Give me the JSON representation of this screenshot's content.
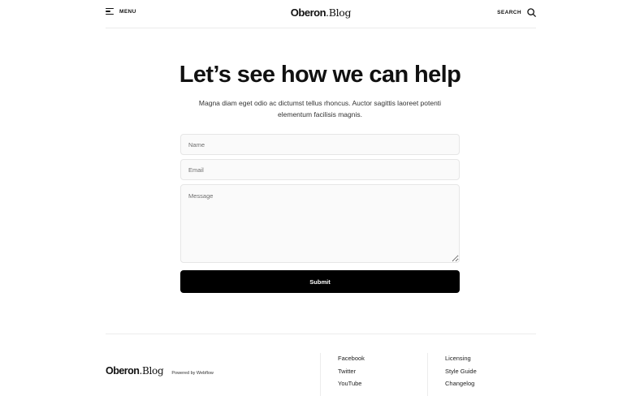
{
  "header": {
    "menu_label": "MENU",
    "logo_part1": "Oberon",
    "logo_part2": ".Blog",
    "search_label": "SEARCH"
  },
  "hero": {
    "title": "Let’s see how we can help",
    "subtitle": "Magna diam eget odio ac dictumst tellus rhoncus. Auctor sagittis laoreet potenti elementum facilisis magnis."
  },
  "form": {
    "name_placeholder": "Name",
    "email_placeholder": "Email",
    "message_placeholder": "Message",
    "submit_label": "Submit"
  },
  "footer": {
    "logo_part1": "Oberon",
    "logo_part2": ".Blog",
    "powered_by": "Powered by Webflow",
    "social_links": [
      "Facebook",
      "Twitter",
      "YouTube"
    ],
    "info_links": [
      "Licensing",
      "Style Guide",
      "Changelog"
    ]
  }
}
